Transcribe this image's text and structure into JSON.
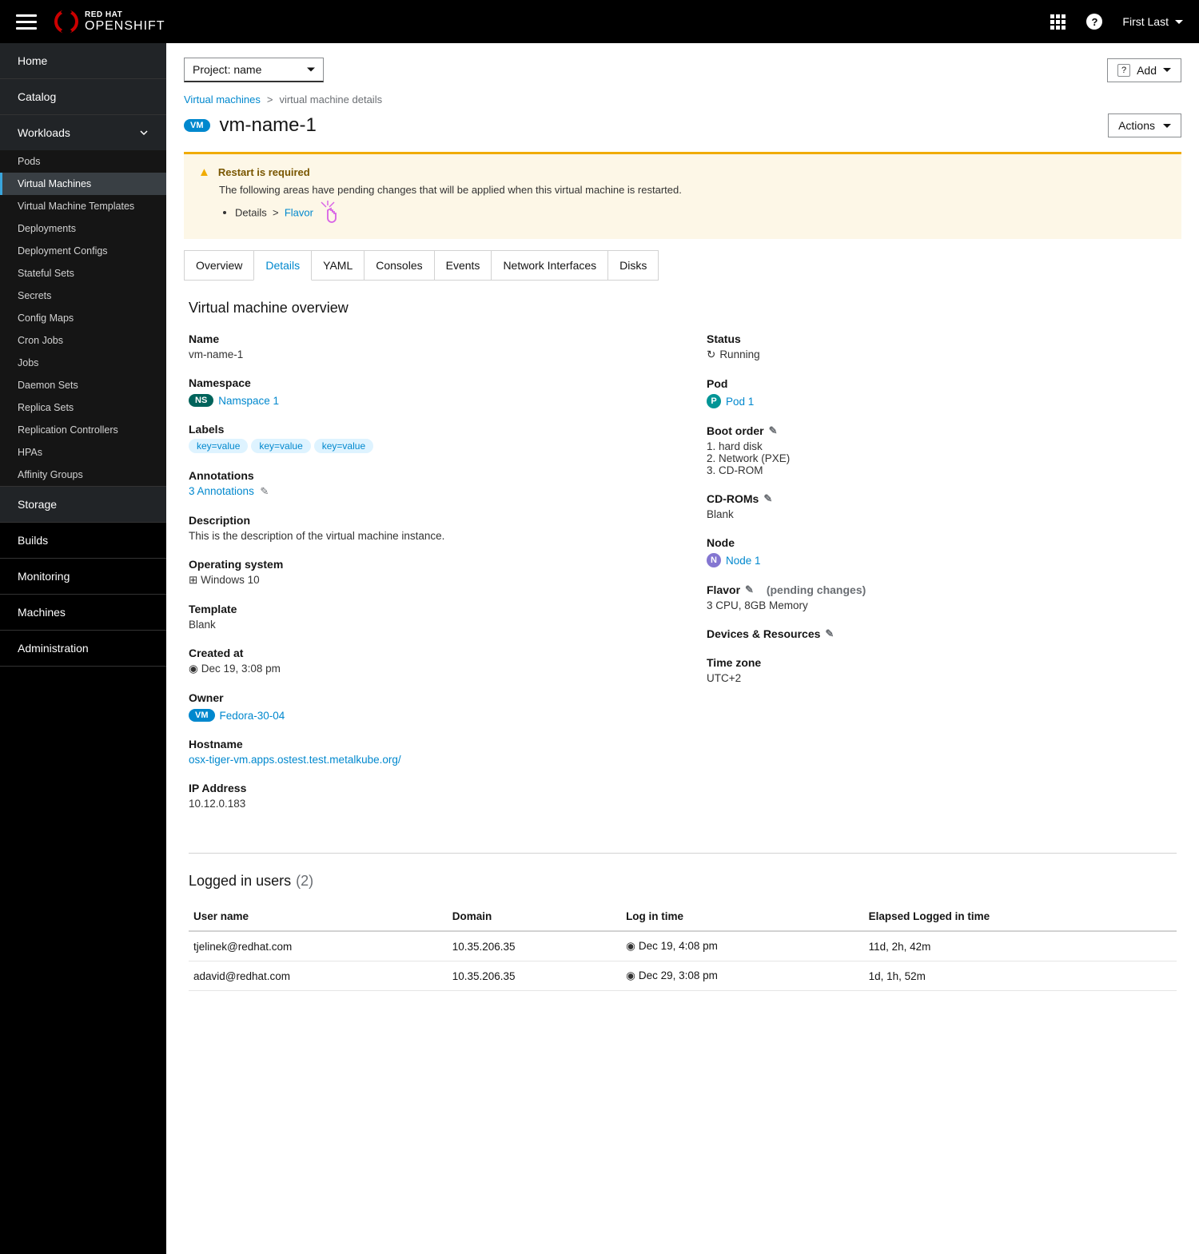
{
  "brand": {
    "top": "RED HAT",
    "main": "OPENSHIFT"
  },
  "header": {
    "user": "First Last"
  },
  "sidebar": {
    "items": [
      {
        "label": "Home"
      },
      {
        "label": "Catalog"
      },
      {
        "label": "Workloads",
        "expanded": true
      },
      {
        "label": "Storage"
      },
      {
        "label": "Builds"
      },
      {
        "label": "Monitoring"
      },
      {
        "label": "Machines"
      },
      {
        "label": "Administration"
      }
    ],
    "workloads_sub": [
      "Pods",
      "Virtual Machines",
      "Virtual Machine Templates",
      "Deployments",
      "Deployment Configs",
      "Stateful Sets",
      "Secrets",
      "Config Maps",
      "Cron Jobs",
      "Jobs",
      "Daemon Sets",
      "Replica Sets",
      "Replication Controllers",
      "HPAs",
      "Affinity Groups"
    ],
    "active_sub": "Virtual Machines"
  },
  "toolbar": {
    "project_label": "Project: name",
    "add_label": "Add"
  },
  "breadcrumb": {
    "root": "Virtual machines",
    "sep": ">",
    "current": "virtual machine details"
  },
  "title": {
    "badge": "VM",
    "text": "vm-name-1"
  },
  "actions_label": "Actions",
  "alert": {
    "title": "Restart is required",
    "body": "The following areas have pending changes that will be applied when this virtual machine is restarted.",
    "pending_area": "Details",
    "pending_sep": ">",
    "pending_link": "Flavor"
  },
  "tabs": [
    "Overview",
    "Details",
    "YAML",
    "Consoles",
    "Events",
    "Network Interfaces",
    "Disks"
  ],
  "active_tab": "Details",
  "details": {
    "section_title": "Virtual machine overview",
    "left": {
      "name": {
        "label": "Name",
        "value": "vm-name-1"
      },
      "namespace": {
        "label": "Namespace",
        "badge": "NS",
        "link": "Namspace 1"
      },
      "labels": {
        "label": "Labels",
        "chips": [
          "key=value",
          "key=value",
          "key=value"
        ]
      },
      "annotations": {
        "label": "Annotations",
        "link": "3 Annotations"
      },
      "description": {
        "label": "Description",
        "value": "This is the description of the virtual machine instance."
      },
      "os": {
        "label": "Operating system",
        "value": "Windows 10"
      },
      "template": {
        "label": "Template",
        "value": "Blank"
      },
      "created": {
        "label": "Created at",
        "value": "Dec 19, 3:08 pm"
      },
      "owner": {
        "label": "Owner",
        "badge": "VM",
        "link": "Fedora-30-04"
      },
      "hostname": {
        "label": "Hostname",
        "link": "osx-tiger-vm.apps.ostest.test.metalkube.org/"
      },
      "ip": {
        "label": "IP Address",
        "value": "10.12.0.183"
      }
    },
    "right": {
      "status": {
        "label": "Status",
        "value": "Running"
      },
      "pod": {
        "label": "Pod",
        "badge": "P",
        "link": "Pod 1"
      },
      "boot": {
        "label": "Boot order",
        "items": [
          "1. hard disk",
          "2. Network (PXE)",
          "3. CD-ROM"
        ]
      },
      "cdroms": {
        "label": "CD-ROMs",
        "value": "Blank"
      },
      "node": {
        "label": "Node",
        "badge": "N",
        "link": "Node 1"
      },
      "flavor": {
        "label": "Flavor",
        "pending": "(pending changes)",
        "value": "3 CPU, 8GB Memory"
      },
      "devices": {
        "label": "Devices & Resources"
      },
      "tz": {
        "label": "Time zone",
        "value": "UTC+2"
      }
    }
  },
  "users": {
    "title": "Logged in users",
    "count": "(2)",
    "headers": [
      "User name",
      "Domain",
      "Log in time",
      "Elapsed Logged in time"
    ],
    "rows": [
      {
        "user": "tjelinek@redhat.com",
        "domain": "10.35.206.35",
        "login": "Dec 19, 4:08 pm",
        "elapsed": "11d, 2h, 42m"
      },
      {
        "user": "adavid@redhat.com",
        "domain": "10.35.206.35",
        "login": "Dec 29, 3:08 pm",
        "elapsed": "1d, 1h, 52m"
      }
    ]
  }
}
